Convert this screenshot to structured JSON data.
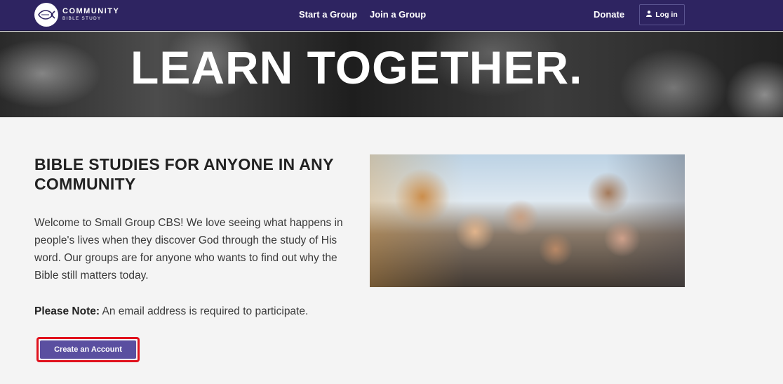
{
  "nav": {
    "logo": {
      "line1": "COMMUNITY",
      "line2": "BIBLE STUDY"
    },
    "links": [
      {
        "label": "Start a Group"
      },
      {
        "label": "Join a Group"
      }
    ],
    "donate_label": "Donate",
    "login_label": "Log in",
    "colors": {
      "bar": "#2e2461"
    }
  },
  "hero": {
    "title": "LEARN TOGETHER."
  },
  "main": {
    "heading": "BIBLE STUDIES FOR ANYONE IN ANY COMMUNITY",
    "welcome": "Welcome to Small Group CBS! We love seeing what happens in people's lives when they discover God through the study of His word. Our groups are for anyone who wants to find out why the Bible still matters today.",
    "note_label": "Please Note:",
    "note_text": " An email address is required to participate.",
    "cta_label": "Create an Account",
    "colors": {
      "cta": "#5a4fa0",
      "cta_highlight": "#e0121d"
    }
  }
}
